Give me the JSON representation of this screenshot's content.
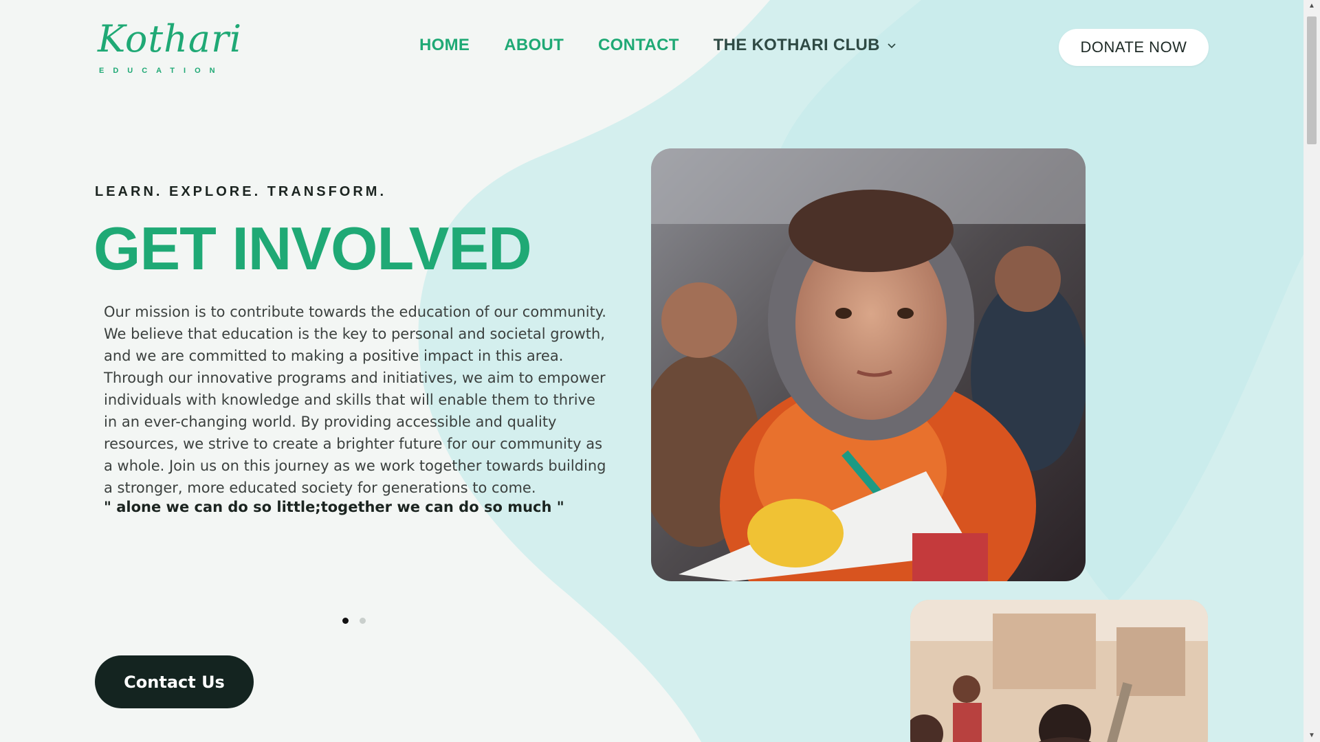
{
  "logo": {
    "script": "Kothari",
    "sub": "EDUCATION"
  },
  "nav": {
    "items": [
      {
        "label": "HOME"
      },
      {
        "label": "ABOUT"
      },
      {
        "label": "CONTACT"
      },
      {
        "label": "THE KOTHARI CLUB"
      }
    ],
    "donate_label": "DONATE NOW"
  },
  "hero": {
    "eyebrow": "LEARN. EXPLORE. TRANSFORM.",
    "title": "GET INVOLVED",
    "mission": "Our mission is to contribute towards the education of our community. We believe that education is the key to personal and societal growth, and we are committed to making a positive impact in this area. Through our innovative programs and initiatives, we aim to empower individuals with knowledge and skills that will enable them to thrive in an ever-changing world. By providing accessible and quality resources, we strive to create a brighter future for our community as a whole. Join us on this journey as we work together towards building a stronger, more educated society for generations to come.",
    "quote": "\" alone we can do so little;together we can do so much \"",
    "slide_count": 2,
    "active_slide": 1,
    "contact_label": "Contact Us"
  },
  "colors": {
    "accent": "#1fa975",
    "dark": "#142420",
    "blob": "#cdeeee",
    "background": "#f3f6f4"
  }
}
